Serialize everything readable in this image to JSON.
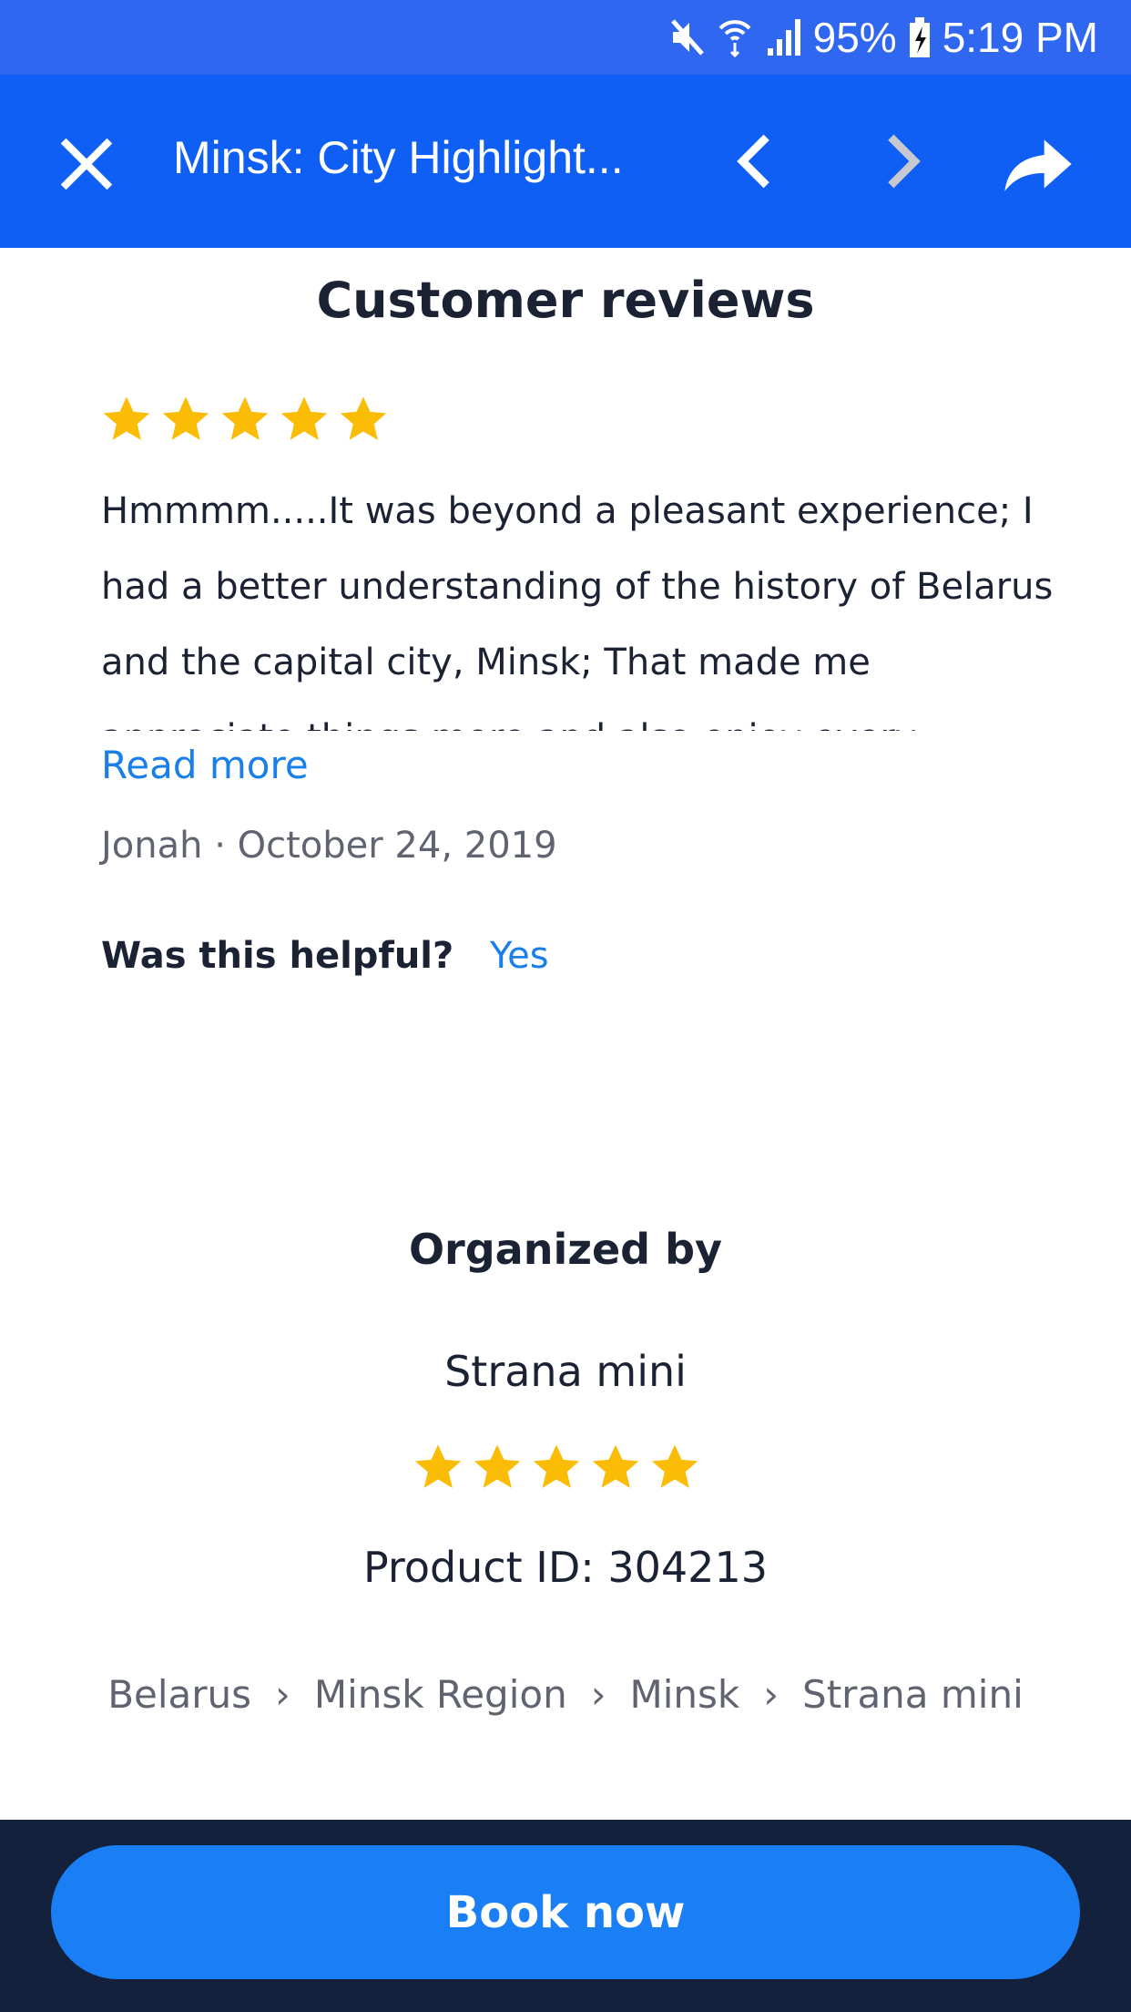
{
  "status_bar": {
    "battery": "95%",
    "time": "5:19 PM",
    "icons": [
      "mute-icon",
      "wifi-icon",
      "signal-icon",
      "battery-charging-icon"
    ]
  },
  "toolbar": {
    "title": "Minsk: City Highlight...",
    "icons": [
      "close-icon",
      "back-chevron-icon",
      "forward-chevron-icon",
      "share-icon"
    ]
  },
  "reviews": {
    "heading": "Customer reviews",
    "items": [
      {
        "rating": 5,
        "text": "Hmmmm.....It was beyond a pleasant experience; I had a better understanding of the history of Belarus and the capital city, Minsk; That made me appreciate things more and also enjoy every",
        "read_more": "Read more",
        "author": "Jonah",
        "separator": "·",
        "date": "October 24, 2019",
        "helpful_label": "Was this helpful?",
        "helpful_yes": "Yes"
      }
    ]
  },
  "organizer": {
    "heading": "Organized by",
    "name": "Strana mini",
    "rating": 5,
    "product_id": "Product ID: 304213"
  },
  "breadcrumb": [
    "Belarus",
    "Minsk Region",
    "Minsk",
    "Strana mini"
  ],
  "footer": {
    "book_label": "Book now"
  },
  "colors": {
    "status_bar": "#3067f0",
    "toolbar": "#0f5ff5",
    "star": "#fbbc05",
    "link": "#1a7fe8",
    "footer": "#14213d",
    "button": "#1a7ff5"
  }
}
